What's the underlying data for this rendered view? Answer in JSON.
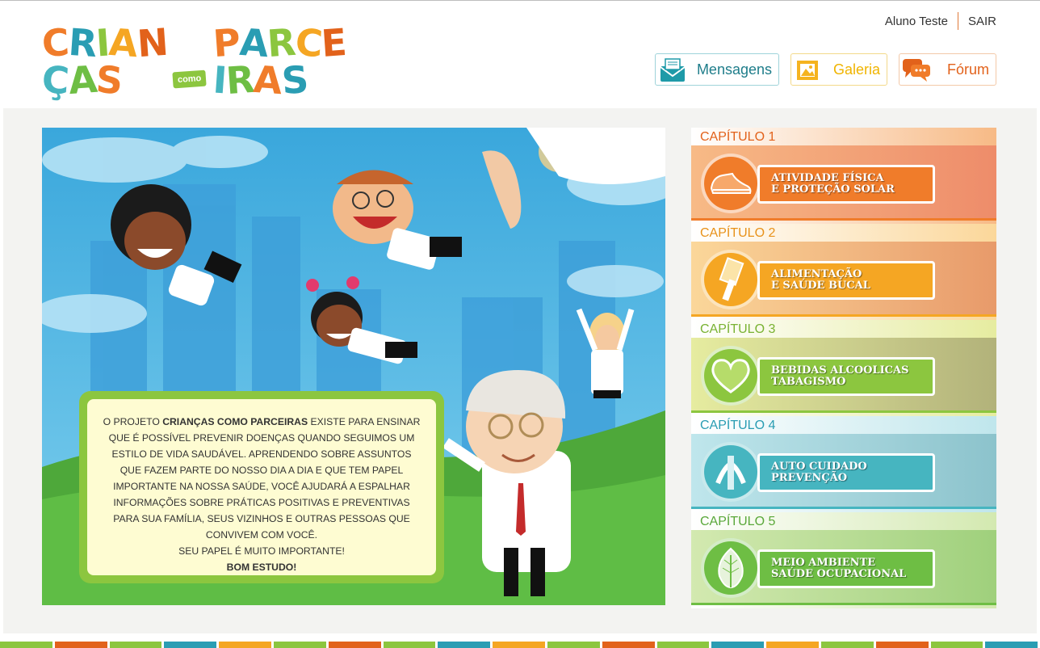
{
  "user": {
    "name": "Aluno Teste",
    "logout": "SAIR"
  },
  "logo": {
    "part1": "CRIANÇAS",
    "part2": "como",
    "part3": "PARCEIRAS"
  },
  "nav": {
    "messages": {
      "label": "Mensagens",
      "icon": "envelope-icon",
      "color": "#1e7d8a"
    },
    "gallery": {
      "label": "Galeria",
      "icon": "picture-frame-icon",
      "color": "#f0b400"
    },
    "forum": {
      "label": "Fórum",
      "icon": "chat-bubbles-icon",
      "color": "#e2621b"
    }
  },
  "intro": {
    "p1_pre": "O PROJETO",
    "p1_bold": "CRIANÇAS COMO PARCEIRAS",
    "p1_post": "EXISTE PARA ENSINAR QUE É POSSÍVEL PREVENIR DOENÇAS QUANDO SEGUIMOS UM ESTILO DE VIDA SAUDÁVEL. APRENDENDO SOBRE ASSUNTOS QUE FAZEM PARTE DO NOSSO DIA A DIA E QUE TEM PAPEL IMPORTANTE NA NOSSA SAÚDE, VOCÊ AJUDARÁ A ESPALHAR INFORMAÇÕES SOBRE PRÁTICAS POSITIVAS E PREVENTIVAS PARA SUA FAMÍLIA, SEUS VIZINHOS E OUTRAS PESSOAS QUE CONVIVEM COM VOCÊ.",
    "p2": "SEU PAPEL É MUITO IMPORTANTE!",
    "p3": "BOM ESTUDO!"
  },
  "chapters": [
    {
      "head": "CAPÍTULO 1",
      "line1": "ATIVIDADE FÍSICA",
      "line2": "E PROTEÇÃO SOLAR",
      "icon": "sneaker-icon",
      "color": "#f07c2a",
      "headColor": "#e2621b",
      "bandFrom": "#f7ba86",
      "bandTo": "#ee8c6a"
    },
    {
      "head": "CAPÍTULO 2",
      "line1": "ALIMENTAÇÃO",
      "line2": "E SAÚDE BUCAL",
      "icon": "toothbrush-icon",
      "color": "#f5a623",
      "headColor": "#e8921a",
      "bandFrom": "#fbd79a",
      "bandTo": "#e89a6a"
    },
    {
      "head": "CAPÍTULO 3",
      "line1": "BEBIDAS ALCOOLICAS",
      "line2": "TABAGISMO",
      "icon": "heart-icon",
      "color": "#8cc63f",
      "headColor": "#79b232",
      "bandFrom": "#e6eca0",
      "bandTo": "#b2b27a"
    },
    {
      "head": "CAPÍTULO 4",
      "line1": "AUTO CUIDADO",
      "line2": "PREVENÇÃO",
      "icon": "hands-icon",
      "color": "#46b5c0",
      "headColor": "#2a9db3",
      "bandFrom": "#bfe6ec",
      "bandTo": "#8cc3cc"
    },
    {
      "head": "CAPÍTULO 5",
      "line1": "MEIO AMBIENTE",
      "line2": "SAÚDE OCUPACIONAL",
      "icon": "leaf-icon",
      "color": "#6ebe44",
      "headColor": "#5aa83a",
      "bandFrom": "#d3e9b0",
      "bandTo": "#9fd07c"
    }
  ],
  "stripeColors": [
    "#8cc63f",
    "#e2621b",
    "#8cc63f",
    "#2a9db3",
    "#f5a623",
    "#8cc63f",
    "#e2621b",
    "#8cc63f",
    "#2a9db3",
    "#f5a623",
    "#8cc63f",
    "#e2621b",
    "#8cc63f",
    "#2a9db3",
    "#f5a623",
    "#8cc63f",
    "#e2621b",
    "#8cc63f",
    "#2a9db3"
  ]
}
